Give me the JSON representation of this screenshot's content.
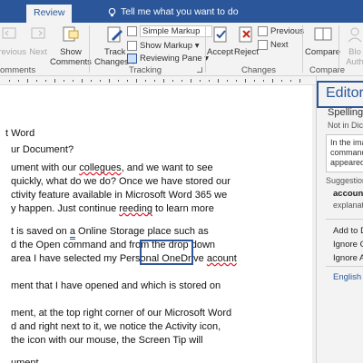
{
  "titlebar": {
    "review_tab": "Review",
    "tell_me": "Tell me what you want to do"
  },
  "ribbon": {
    "comments": {
      "previous": "Previous",
      "next": "Next",
      "show_comments_1": "Show",
      "show_comments_2": "Comments",
      "group": "omments"
    },
    "tracking": {
      "track_changes_1": "Track",
      "track_changes_2": "Changes ▾",
      "markup_dropdown": "Simple Markup",
      "show_markup": "Show Markup ▾",
      "reviewing_pane": "Reviewing Pane ▾",
      "group": "Tracking"
    },
    "changes": {
      "accept": "Accept",
      "reject": "Reject",
      "previous": "Previous",
      "next": "Next",
      "group": "Changes"
    },
    "compare": {
      "compare": "Compare",
      "group": "Compare"
    },
    "protect": {
      "block_1": "Blo",
      "block_2": "Auth"
    }
  },
  "document": {
    "lines": [
      {
        "id": "l1",
        "parts": [
          {
            "t": "t Word"
          }
        ]
      },
      {
        "id": "l2",
        "parts": [
          {
            "t": "ur Document?"
          }
        ]
      },
      {
        "id": "l3",
        "parts": [
          {
            "t": "ument with our "
          },
          {
            "t": "collegues",
            "style": "sq-red"
          },
          {
            "t": ", and we want to see"
          }
        ]
      },
      {
        "id": "l4",
        "parts": [
          {
            "t": "quickly, what do we do?  Once we have stored our"
          }
        ]
      },
      {
        "id": "l5",
        "parts": [
          {
            "t": "ctivity feature available in Microsoft Word 365 we"
          }
        ]
      },
      {
        "id": "l6",
        "parts": [
          {
            "t": "y happen.  Just continue "
          },
          {
            "t": "reeding",
            "style": "sq-red"
          },
          {
            "t": " to learn more"
          }
        ]
      },
      {
        "id": "l7",
        "parts": [
          {
            "t": "t is saved on "
          },
          {
            "t": "a",
            "style": "dbl-blue"
          },
          {
            "t": " Online Storage place such as"
          }
        ]
      },
      {
        "id": "l8",
        "parts": [
          {
            "t": "d the Open command and from the drop down"
          }
        ]
      },
      {
        "id": "l9",
        "parts": [
          {
            "t": " area I have selected my Personal OneDrive "
          },
          {
            "t": "acount",
            "style": "sq-red"
          }
        ]
      },
      {
        "id": "l10",
        "parts": [
          {
            "t": "ment that I have opened and which is stored on"
          }
        ]
      },
      {
        "id": "l11",
        "parts": [
          {
            "t": "ment, at the top right corner of our Microsoft Word"
          }
        ]
      },
      {
        "id": "l12",
        "parts": [
          {
            "t": "d and right next to it, we notice the Activity icon,"
          }
        ]
      },
      {
        "id": "l13",
        "parts": [
          {
            "t": " the icon with our mouse, the Screen Tip will"
          }
        ]
      },
      {
        "id": "l14",
        "parts": [
          {
            "t": "ument"
          }
        ]
      }
    ]
  },
  "editor_pane": {
    "title": "Editor",
    "spelling": "Spelling",
    "not_in_dictionary": "Not in Dictio",
    "preview_lines": [
      "In the imag",
      "command",
      "appeared A"
    ],
    "suggestions_label": "Suggestions",
    "suggestion": "account",
    "explanation": "explanatio",
    "add_to_dictionary": "Add to Dic",
    "ignore_once": "Ignore Onc",
    "ignore_all": "Ignore All",
    "language": "English (U"
  },
  "colors": {
    "accent": "#2b579a",
    "spelling_error": "#e81123",
    "grammar_error": "#2b5797"
  }
}
